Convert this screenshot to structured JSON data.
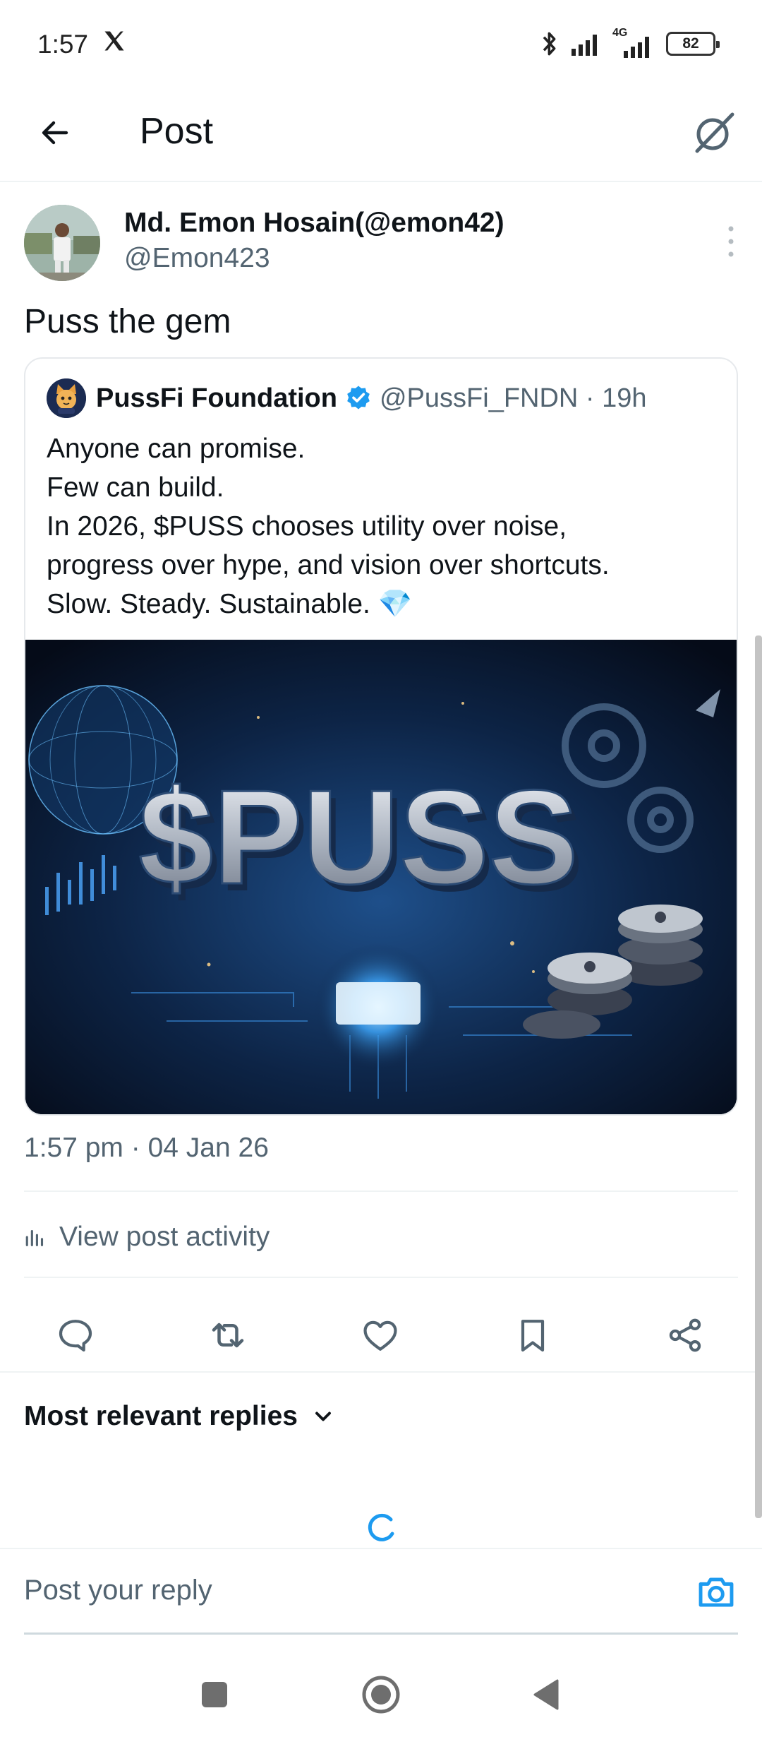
{
  "status_bar": {
    "time": "1:57",
    "network_label": "4G",
    "battery": "82"
  },
  "header": {
    "title": "Post",
    "back_icon": "back-arrow-icon",
    "grok_icon": "grok-icon"
  },
  "post": {
    "author_name": "Md. Emon Hosain(@emon42)",
    "author_handle": "@Emon423",
    "text": "Puss the gem",
    "timestamp": "1:57 pm · 04 Jan 26",
    "view_activity_label": "View post activity"
  },
  "quote": {
    "name": "PussFi Foundation",
    "handle_time": "@PussFi_FNDN · 19h",
    "lines": [
      "Anyone can promise.",
      "Few can build.",
      "In 2026, $PUSS chooses utility over noise,",
      "progress over hype, and vision over shortcuts.",
      "Slow. Steady. Sustainable. 💎"
    ],
    "image_text": "$PUSS",
    "verified_color": "#1d9bf0"
  },
  "actions": [
    "reply-icon",
    "repost-icon",
    "like-icon",
    "bookmark-icon",
    "share-icon"
  ],
  "replies": {
    "sort_label": "Most relevant replies"
  },
  "reply_bar": {
    "placeholder": "Post your reply"
  },
  "colors": {
    "accent": "#1d9bf0",
    "text_primary": "#0f1419",
    "text_secondary": "#536471"
  }
}
